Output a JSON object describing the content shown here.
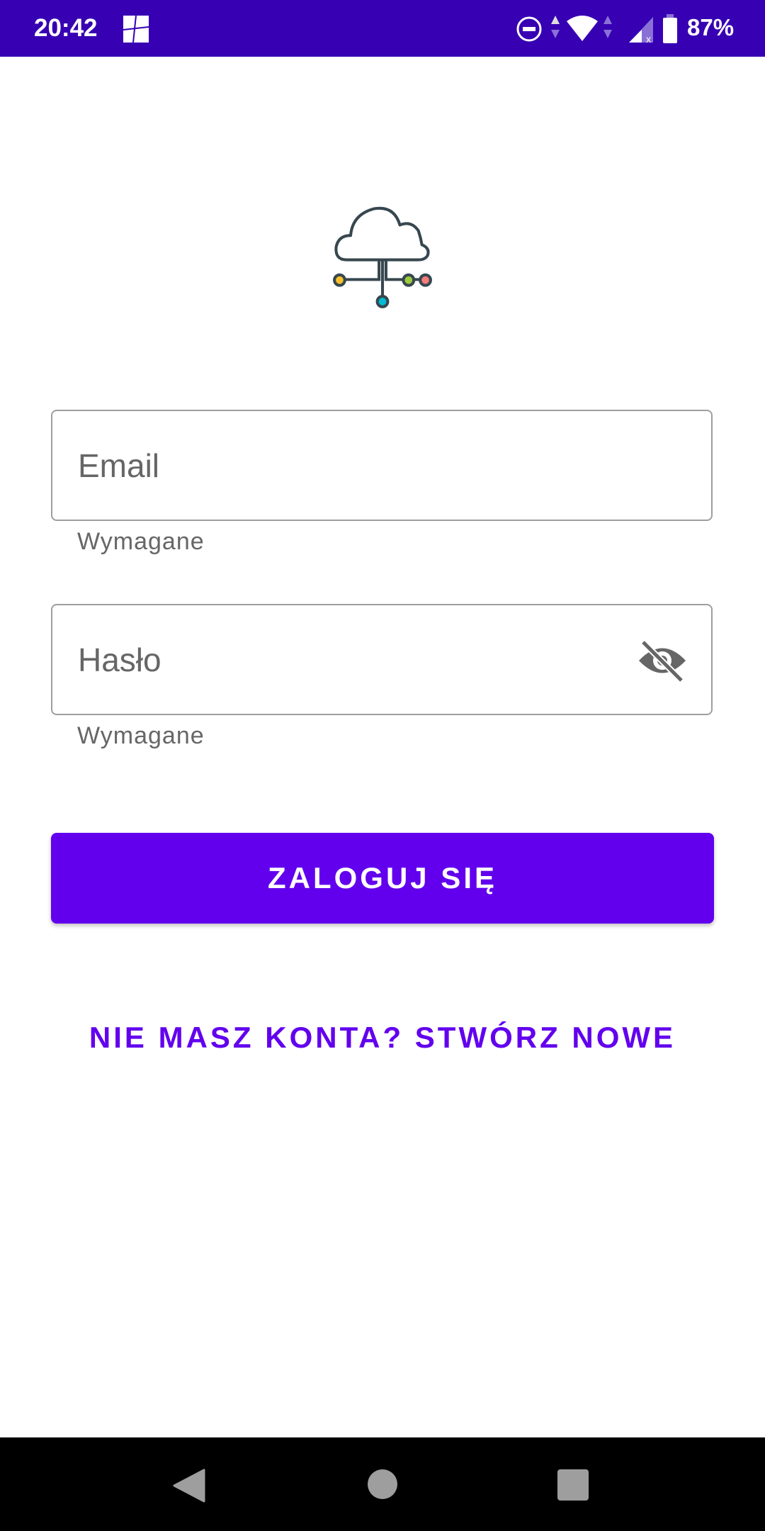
{
  "status_bar": {
    "time": "20:42",
    "battery": "87%",
    "icons": [
      "notification-app-icon",
      "do-not-disturb-icon",
      "data-arrows-icon",
      "wifi-icon",
      "cellular-no-signal-icon",
      "battery-icon"
    ]
  },
  "form": {
    "email": {
      "placeholder": "Email",
      "helper": "Wymagane"
    },
    "password": {
      "placeholder": "Hasło",
      "helper": "Wymagane",
      "toggle_icon": "visibility-off-icon"
    }
  },
  "login_button": "ZALOGUJ SIĘ",
  "register_link": "NIE MASZ KONTA? STWÓRZ NOWE",
  "colors": {
    "primary": "#6200ee",
    "status_bar": "#3700b3"
  },
  "nav_bar": {
    "icons": [
      "back-icon",
      "home-icon",
      "recents-icon"
    ]
  }
}
